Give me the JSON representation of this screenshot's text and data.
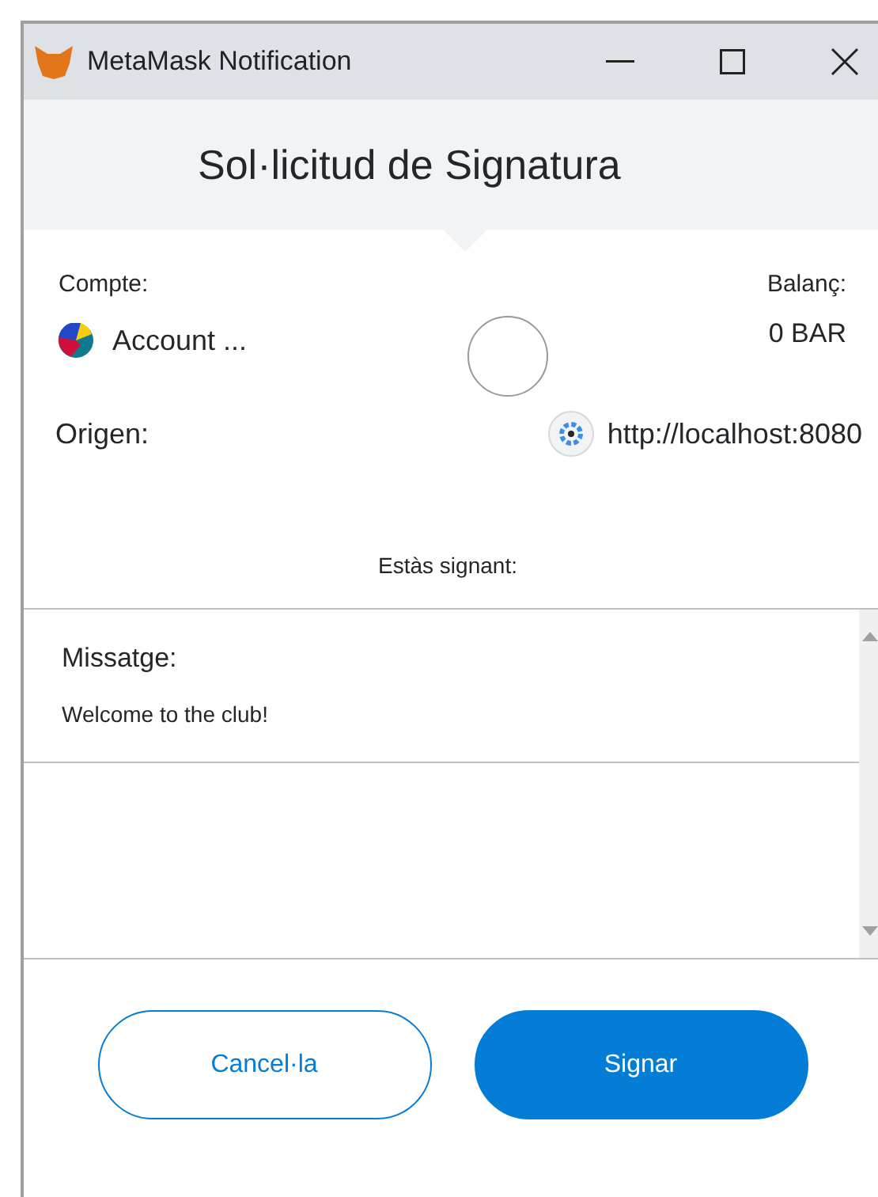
{
  "window": {
    "title": "MetaMask Notification"
  },
  "header": {
    "title": "Sol·licitud de Signatura"
  },
  "account": {
    "label": "Compte:",
    "name": "Account ...",
    "balance_label": "Balanç:",
    "balance": "0 BAR"
  },
  "origin": {
    "label": "Origen:",
    "url": "http://localhost:8080"
  },
  "signing_label": "Estàs signant:",
  "message": {
    "label": "Missatge:",
    "text": "Welcome to the club!"
  },
  "buttons": [
    {
      "label": "Cancel·la",
      "kind": "secondary"
    },
    {
      "label": "Signar",
      "kind": "primary"
    }
  ]
}
